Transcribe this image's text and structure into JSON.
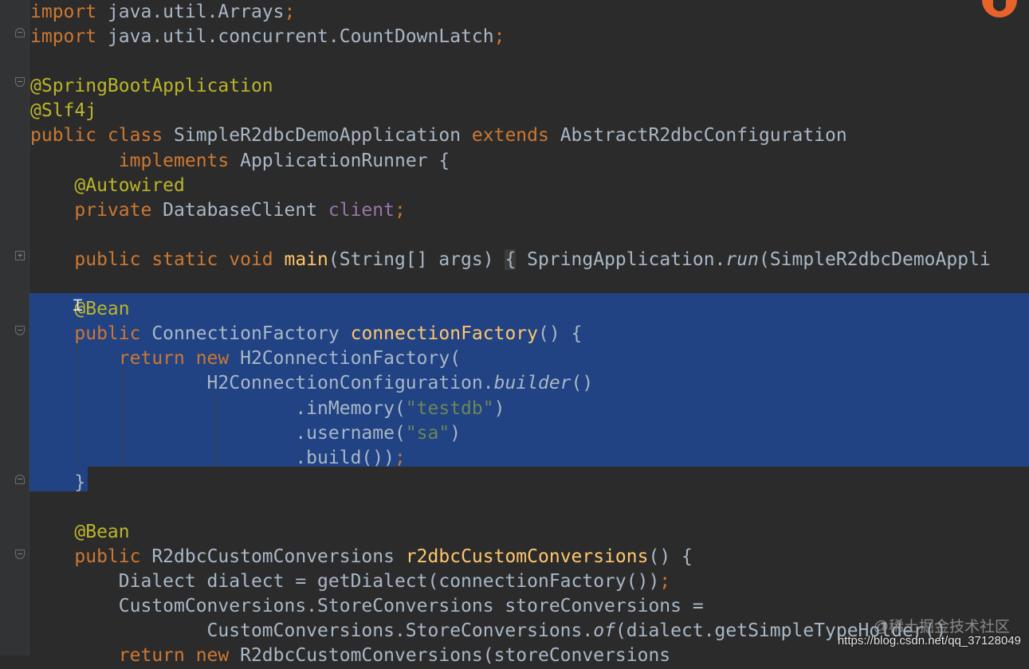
{
  "editor": {
    "lines": [
      [
        {
          "t": "import",
          "c": "kw"
        },
        {
          "t": " java.util.Arrays"
        },
        {
          "t": ";",
          "c": "kw"
        }
      ],
      [
        {
          "t": "import",
          "c": "kw"
        },
        {
          "t": " java.util.concurrent.CountDownLatch"
        },
        {
          "t": ";",
          "c": "kw"
        }
      ],
      [],
      [
        {
          "t": "@SpringBootApplication",
          "c": "ann"
        }
      ],
      [
        {
          "t": "@Slf4j",
          "c": "ann"
        }
      ],
      [
        {
          "t": "public class",
          "c": "kw"
        },
        {
          "t": " SimpleR2dbcDemoApplication "
        },
        {
          "t": "extends",
          "c": "kw"
        },
        {
          "t": " AbstractR2dbcConfiguration"
        }
      ],
      [
        {
          "t": "        "
        },
        {
          "t": "implements",
          "c": "kw"
        },
        {
          "t": " ApplicationRunner {"
        }
      ],
      [
        {
          "t": "    "
        },
        {
          "t": "@Autowired",
          "c": "ann"
        }
      ],
      [
        {
          "t": "    "
        },
        {
          "t": "private",
          "c": "kw"
        },
        {
          "t": " DatabaseClient "
        },
        {
          "t": "client",
          "c": "fld"
        },
        {
          "t": ";",
          "c": "kw"
        }
      ],
      [],
      [
        {
          "t": "    "
        },
        {
          "t": "public static void",
          "c": "kw"
        },
        {
          "t": " "
        },
        {
          "t": "main",
          "c": "fn"
        },
        {
          "t": "(String[] args) "
        },
        {
          "t": "{",
          "c": "brace-hl"
        },
        {
          "t": " SpringApplication."
        },
        {
          "t": "run",
          "c": "it"
        },
        {
          "t": "(SimpleR2dbcDemoAppli"
        }
      ],
      [],
      [
        {
          "t": "    "
        },
        {
          "t": "@Bean",
          "c": "ann"
        }
      ],
      [
        {
          "t": "    "
        },
        {
          "t": "public",
          "c": "kw"
        },
        {
          "t": " ConnectionFactory "
        },
        {
          "t": "connectionFactory",
          "c": "fn"
        },
        {
          "t": "() {"
        }
      ],
      [
        {
          "t": "        "
        },
        {
          "t": "return new",
          "c": "kw"
        },
        {
          "t": " H2ConnectionFactory("
        }
      ],
      [
        {
          "t": "                H2ConnectionConfiguration."
        },
        {
          "t": "builder",
          "c": "it"
        },
        {
          "t": "()"
        }
      ],
      [
        {
          "t": "                        .inMemory("
        },
        {
          "t": "\"testdb\"",
          "c": "str"
        },
        {
          "t": ")"
        }
      ],
      [
        {
          "t": "                        .username("
        },
        {
          "t": "\"sa\"",
          "c": "str"
        },
        {
          "t": ")"
        }
      ],
      [
        {
          "t": "                        .build())"
        },
        {
          "t": ";",
          "c": "kw"
        }
      ],
      [
        {
          "t": "    }"
        }
      ],
      [],
      [
        {
          "t": "    "
        },
        {
          "t": "@Bean",
          "c": "ann"
        }
      ],
      [
        {
          "t": "    "
        },
        {
          "t": "public",
          "c": "kw"
        },
        {
          "t": " R2dbcCustomConversions "
        },
        {
          "t": "r2dbcCustomConversions",
          "c": "fn"
        },
        {
          "t": "() {"
        }
      ],
      [
        {
          "t": "        Dialect dialect = getDialect(connectionFactory())"
        },
        {
          "t": ";",
          "c": "kw"
        }
      ],
      [
        {
          "t": "        CustomConversions.StoreConversions storeConversions ="
        }
      ],
      [
        {
          "t": "                CustomConversions.StoreConversions."
        },
        {
          "t": "of",
          "c": "it"
        },
        {
          "t": "(dialect.getSimpleTypeHolder()"
        }
      ],
      [
        {
          "t": "        "
        },
        {
          "t": "return new",
          "c": "kw"
        },
        {
          "t": " R2dbcCustomConversions(storeConversions"
        }
      ]
    ]
  },
  "watermark": {
    "url": "https://blog.csdn.net/qq_37128049",
    "site": "@稀土掘金技术社区"
  }
}
